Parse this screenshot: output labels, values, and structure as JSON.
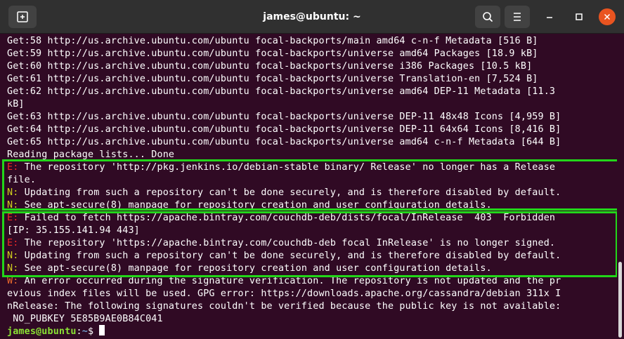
{
  "window": {
    "title": "james@ubuntu: ~"
  },
  "titlebar": {
    "icons": [
      "new-tab-icon",
      "search-icon",
      "hamburger-menu-icon",
      "minimize-icon",
      "maximize-icon",
      "close-icon"
    ],
    "close_color": "#e95420"
  },
  "colors": {
    "background": "#300a24",
    "error": "#ef2929",
    "notice": "#cfcf1f",
    "warning": "#ef6a2d",
    "prompt_user": "#8ae234",
    "prompt_path": "#729fcf",
    "highlight_border": "#22d61a"
  },
  "terminal": {
    "lines": [
      {
        "prefix": "",
        "text": "Get:58 http://us.archive.ubuntu.com/ubuntu focal-backports/main amd64 c-n-f Metadata [516 B]"
      },
      {
        "prefix": "",
        "text": "Get:59 http://us.archive.ubuntu.com/ubuntu focal-backports/universe amd64 Packages [18.9 kB]"
      },
      {
        "prefix": "",
        "text": "Get:60 http://us.archive.ubuntu.com/ubuntu focal-backports/universe i386 Packages [10.5 kB]"
      },
      {
        "prefix": "",
        "text": "Get:61 http://us.archive.ubuntu.com/ubuntu focal-backports/universe Translation-en [7,524 B]"
      },
      {
        "prefix": "",
        "text": "Get:62 http://us.archive.ubuntu.com/ubuntu focal-backports/universe amd64 DEP-11 Metadata [11.3"
      },
      {
        "prefix": "",
        "text": "kB]"
      },
      {
        "prefix": "",
        "text": "Get:63 http://us.archive.ubuntu.com/ubuntu focal-backports/universe DEP-11 48x48 Icons [4,959 B]"
      },
      {
        "prefix": "",
        "text": "Get:64 http://us.archive.ubuntu.com/ubuntu focal-backports/universe DEP-11 64x64 Icons [8,416 B]"
      },
      {
        "prefix": "",
        "text": "Get:65 http://us.archive.ubuntu.com/ubuntu focal-backports/universe amd64 c-n-f Metadata [644 B]"
      },
      {
        "prefix": "",
        "text": "Reading package lists... Done"
      },
      {
        "prefix": "E:",
        "text": " The repository 'http://pkg.jenkins.io/debian-stable binary/ Release' no longer has a Release"
      },
      {
        "prefix": "",
        "text": "file."
      },
      {
        "prefix": "N:",
        "text": " Updating from such a repository can't be done securely, and is therefore disabled by default."
      },
      {
        "prefix": "N:",
        "text": " See apt-secure(8) manpage for repository creation and user configuration details."
      },
      {
        "prefix": "E:",
        "text": " Failed to fetch https://apache.bintray.com/couchdb-deb/dists/focal/InRelease  403  Forbidden"
      },
      {
        "prefix": "",
        "text": "[IP: 35.155.141.94 443]"
      },
      {
        "prefix": "E:",
        "text": " The repository 'https://apache.bintray.com/couchdb-deb focal InRelease' is no longer signed."
      },
      {
        "prefix": "N:",
        "text": " Updating from such a repository can't be done securely, and is therefore disabled by default."
      },
      {
        "prefix": "N:",
        "text": " See apt-secure(8) manpage for repository creation and user configuration details."
      },
      {
        "prefix": "W:",
        "text": " An error occurred during the signature verification. The repository is not updated and the pr"
      },
      {
        "prefix": "",
        "text": "evious index files will be used. GPG error: https://downloads.apache.org/cassandra/debian 311x I"
      },
      {
        "prefix": "",
        "text": "nRelease: The following signatures couldn't be verified because the public key is not available:"
      },
      {
        "prefix": "",
        "text": " NO_PUBKEY 5E85B9AE0B84C041"
      }
    ],
    "prompt": {
      "user": "james@ubuntu",
      "separator": ":",
      "path": "~",
      "symbol": "$ "
    }
  }
}
